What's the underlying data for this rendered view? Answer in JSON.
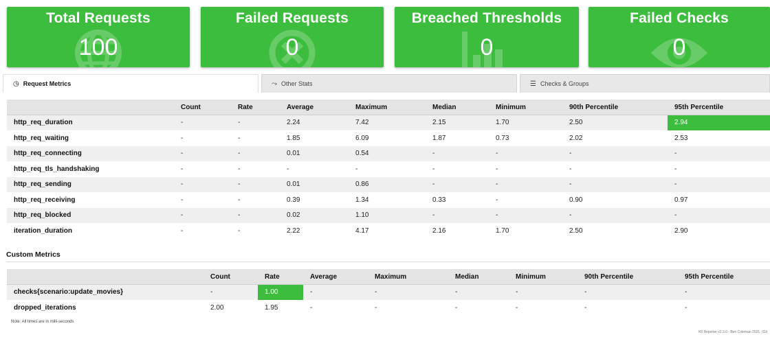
{
  "colors": {
    "accent_green": "#3dbd3d",
    "tab_inactive": "#e8e8e8",
    "header_bg": "#e4e4e4"
  },
  "cards": [
    {
      "title": "Total Requests",
      "value": "100",
      "icon": "globe-icon"
    },
    {
      "title": "Failed Requests",
      "value": "0",
      "icon": "cross-circle-icon"
    },
    {
      "title": "Breached Thresholds",
      "value": "0",
      "icon": "chart-icon"
    },
    {
      "title": "Failed Checks",
      "value": "0",
      "icon": "eye-icon"
    }
  ],
  "tabs": [
    {
      "label": "Request Metrics",
      "icon": "clock-icon",
      "glyph": "◷"
    },
    {
      "label": "Other Stats",
      "icon": "line-chart-icon",
      "glyph": "⤳"
    },
    {
      "label": "Checks & Groups",
      "icon": "list-icon",
      "glyph": "☰"
    }
  ],
  "request_metrics": {
    "columns": [
      "",
      "Count",
      "Rate",
      "Average",
      "Maximum",
      "Median",
      "Minimum",
      "90th Percentile",
      "95th Percentile"
    ],
    "rows": [
      {
        "name": "http_req_duration",
        "cells": [
          "-",
          "-",
          "2.24",
          "7.42",
          "2.15",
          "1.70",
          "2.50",
          "2.94"
        ]
      },
      {
        "name": "http_req_waiting",
        "cells": [
          "-",
          "-",
          "1.85",
          "6.09",
          "1.87",
          "0.73",
          "2.02",
          "2.53"
        ]
      },
      {
        "name": "http_req_connecting",
        "cells": [
          "-",
          "-",
          "0.01",
          "0.54",
          "-",
          "-",
          "-",
          "-"
        ]
      },
      {
        "name": "http_req_tls_handshaking",
        "cells": [
          "-",
          "-",
          "-",
          "-",
          "-",
          "-",
          "-",
          "-"
        ]
      },
      {
        "name": "http_req_sending",
        "cells": [
          "-",
          "-",
          "0.01",
          "0.86",
          "-",
          "-",
          "-",
          "-"
        ]
      },
      {
        "name": "http_req_receiving",
        "cells": [
          "-",
          "-",
          "0.39",
          "1.34",
          "0.33",
          "-",
          "0.90",
          "0.97"
        ]
      },
      {
        "name": "http_req_blocked",
        "cells": [
          "-",
          "-",
          "0.02",
          "1.10",
          "-",
          "-",
          "-",
          "-"
        ]
      },
      {
        "name": "iteration_duration",
        "cells": [
          "-",
          "-",
          "2.22",
          "4.17",
          "2.16",
          "1.70",
          "2.50",
          "2.90"
        ]
      }
    ]
  },
  "custom_metrics": {
    "title": "Custom Metrics",
    "columns": [
      "",
      "Count",
      "Rate",
      "Average",
      "Maximum",
      "Median",
      "Minimum",
      "90th Percentile",
      "95th Percentile"
    ],
    "rows": [
      {
        "name": "checks{scenario:update_movies}",
        "cells": [
          "-",
          "1.00",
          "-",
          "-",
          "-",
          "-",
          "-",
          "-"
        ]
      },
      {
        "name": "dropped_iterations",
        "cells": [
          "2.00",
          "1.95",
          "-",
          "-",
          "-",
          "-",
          "-",
          "-"
        ]
      }
    ]
  },
  "note": "Note. All times are in milli-seconds",
  "footer": "K6 Reporter v2.3.0 - Ben Coleman 2021, (Git"
}
